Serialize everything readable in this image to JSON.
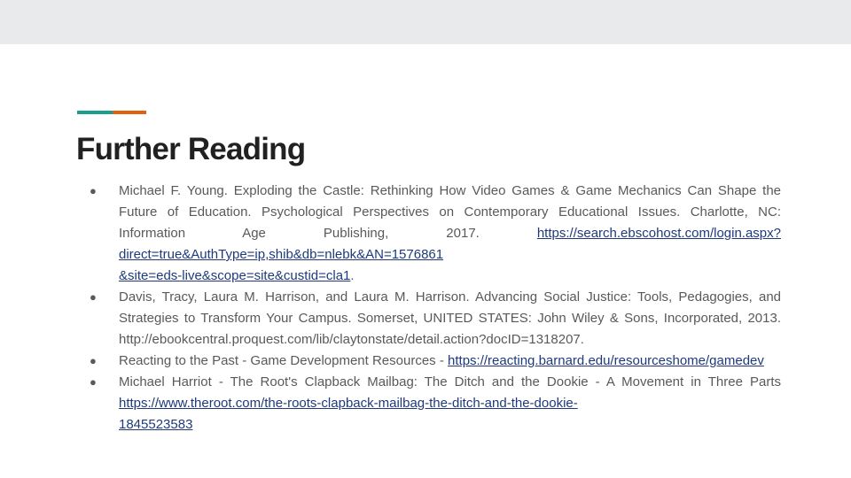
{
  "title": "Further Reading",
  "colors": {
    "top_band": "#e8eaeb",
    "accent_teal": "#1a9c8f",
    "accent_orange": "#e0600e",
    "title": "#212121",
    "body_text": "#595959",
    "link": "#1f3a7a"
  },
  "bullet_glyph": "●",
  "references": [
    {
      "text": "Michael F. Young. Exploding the Castle: Rethinking How Video Games & Game Mechanics Can Shape the Future of Education. Psychological Perspectives on Contemporary Educational Issues. Charlotte, NC: Information Age Publishing, 2017. ",
      "link_line1": "https://search.ebscohost.com/login.aspx?direct=true&AuthType=ip,shib&db=nlebk&AN=1576861",
      "link_line2": "&site=eds-live&scope=site&custid=cla1",
      "after": "."
    },
    {
      "text": "Davis, Tracy, Laura M. Harrison, and Laura M. Harrison. Advancing Social Justice: Tools, Pedagogies, and Strategies to Transform Your Campus. Somerset, UNITED STATES: John Wiley & Sons, Incorporated, 2013. http://ebookcentral.proquest.com/lib/claytonstate/detail.action?docID=1318207."
    },
    {
      "text": "Reacting to the Past - Game Development Resources - ",
      "link": "https://reacting.barnard.edu/resourceshome/gamedev"
    },
    {
      "text": "Michael Harriot - The Root's Clapback Mailbag: The Ditch and the Dookie - A Movement in Three Parts ",
      "link_line1": "https://www.theroot.com/the-roots-clapback-mailbag-the-ditch-and-the-dookie-",
      "link_line2": "1845523583"
    }
  ]
}
